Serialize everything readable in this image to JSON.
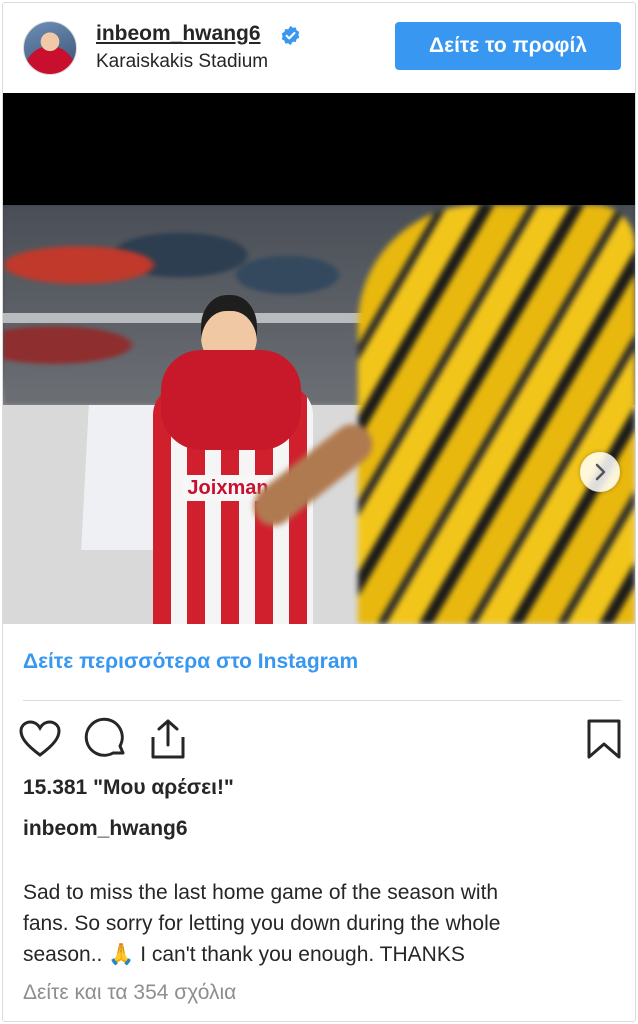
{
  "header": {
    "username": "inbeom_hwang6",
    "location": "Karaiskakis Stadium",
    "profile_button": "Δείτε το προφίλ"
  },
  "media": {
    "sponsor_text": "Joixman",
    "carousel_dots": 2,
    "active_dot": 1
  },
  "see_more_link": "Δείτε περισσότερα στο Instagram",
  "likes": "15.381 \"Μου αρέσει!\"",
  "caption_author": "inbeom_hwang6",
  "caption": {
    "line1": "Sad to miss the last home game of the season with",
    "line2": "fans. So sorry for letting you down during the whole",
    "line3": "season.. 🙏 I can't thank you enough. THANKS"
  },
  "comments_link": "Δείτε και τα 354 σχόλια",
  "colors": {
    "accent": "#3897f0",
    "text": "#262626",
    "muted": "#8e8e8e"
  },
  "icons": [
    "verified-badge-icon",
    "heart-icon",
    "comment-icon",
    "share-icon",
    "bookmark-icon",
    "chevron-right-icon"
  ]
}
